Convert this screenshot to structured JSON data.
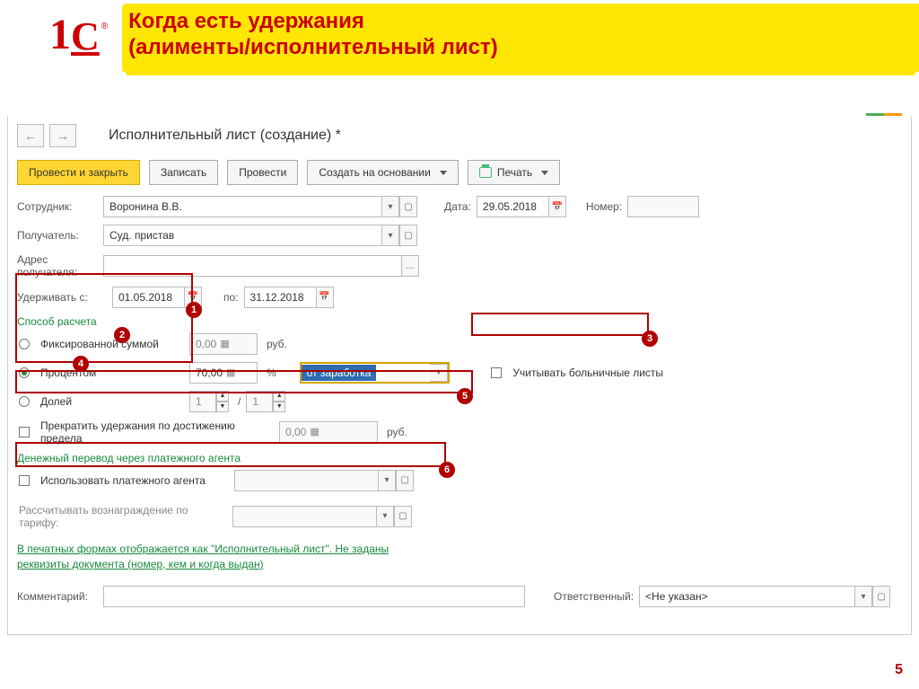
{
  "slide": {
    "title_line1": "Когда есть удержания",
    "title_line2": "(алименты/исполнительный лист)",
    "page_number": "5"
  },
  "header": {
    "title": "Исполнительный лист (создание) *"
  },
  "toolbar": {
    "post_close": "Провести и закрыть",
    "save": "Записать",
    "post": "Провести",
    "create_based": "Создать на основании",
    "print": "Печать"
  },
  "labels": {
    "employee": "Сотрудник:",
    "recipient": "Получатель:",
    "address": "Адрес получателя:",
    "date": "Дата:",
    "number": "Номер:",
    "deduct_from": "Удерживать с:",
    "to": "по:",
    "calc_method": "Способ расчета",
    "fixed_sum": "Фиксированной суммой",
    "percent": "Процентом",
    "fraction": "Долей",
    "stop_limit": "Прекратить удержания по достижению предела",
    "consider_sick": "Учитывать больничные листы",
    "agent_section": "Денежный перевод через платежного агента",
    "use_agent": "Использовать платежного агента",
    "tariff": "Рассчитывать вознаграждение по тарифу:",
    "print_form_note": "В печатных формах отображается как \"Исполнительный лист\". Не заданы реквизиты документа (номер, кем и когда выдан)",
    "comment": "Комментарий:",
    "responsible": "Ответственный:",
    "rub": "руб.",
    "pct": "%",
    "slash": "/"
  },
  "values": {
    "employee": "Воронина В.В.",
    "recipient": "Суд. пристав",
    "address": "",
    "date": "29.05.2018",
    "number": "",
    "from_date": "01.05.2018",
    "to_date": "31.12.2018",
    "fixed_amount": "0,00",
    "percent_amount": "70,00",
    "percent_base": "от заработка",
    "fraction_num": "1",
    "fraction_den": "1",
    "limit_amount": "0,00",
    "agent_name": "",
    "tariff_value": "",
    "comment": "",
    "responsible": "<Не указан>"
  },
  "markers": {
    "m1": "1",
    "m2": "2",
    "m3": "3",
    "m4": "4",
    "m5": "5",
    "m6": "6"
  }
}
